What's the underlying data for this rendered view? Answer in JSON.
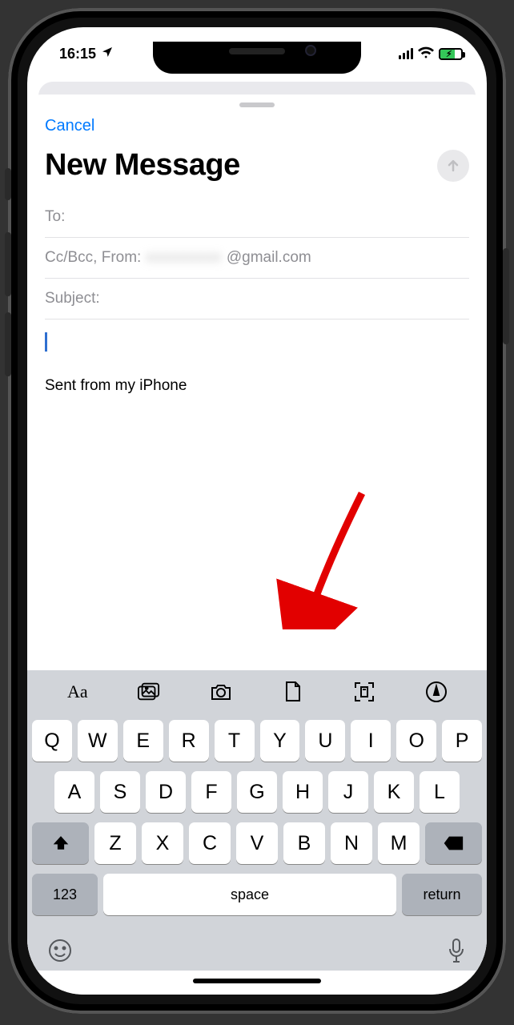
{
  "status": {
    "time": "16:15"
  },
  "sheet": {
    "cancel": "Cancel",
    "title": "New Message",
    "to_label": "To:",
    "cc_label": "Cc/Bcc, From:",
    "from_masked": "xxxxxxxxx",
    "from_domain": "@gmail.com",
    "subject_label": "Subject:",
    "signature": "Sent from my iPhone"
  },
  "keyboard": {
    "row1": [
      "Q",
      "W",
      "E",
      "R",
      "T",
      "Y",
      "U",
      "I",
      "O",
      "P"
    ],
    "row2": [
      "A",
      "S",
      "D",
      "F",
      "G",
      "H",
      "J",
      "K",
      "L"
    ],
    "row3": [
      "Z",
      "X",
      "C",
      "V",
      "B",
      "N",
      "M"
    ],
    "numeric": "123",
    "space": "space",
    "return": "return"
  }
}
